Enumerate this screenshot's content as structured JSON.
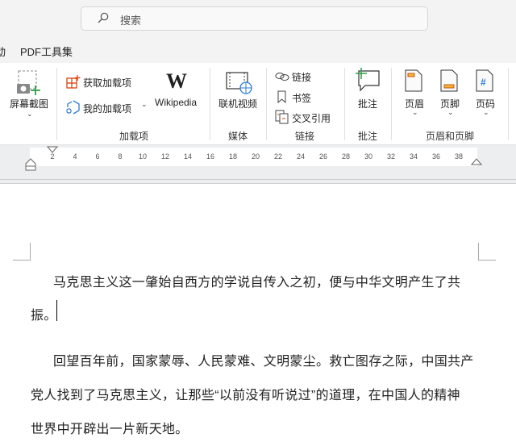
{
  "search": {
    "placeholder": "搜索"
  },
  "tabs": [
    {
      "label": "动"
    },
    {
      "label": "PDF工具集"
    }
  ],
  "ribbon": {
    "screenshot": "屏幕截图",
    "get_addins": "获取加载项",
    "my_addins": "我的加载项",
    "wikipedia": "Wikipedia",
    "online_video": "联机视频",
    "link": "链接",
    "bookmark": "书签",
    "cross_ref": "交叉引用",
    "comment": "批注",
    "header": "页眉",
    "footer": "页脚",
    "page_number": "页码",
    "groups": {
      "addins": "加载项",
      "media": "媒体",
      "links": "链接",
      "comments": "批注",
      "header_footer": "页眉和页脚"
    }
  },
  "ruler": {
    "ticks": [
      "2",
      "4",
      "6",
      "8",
      "10",
      "12",
      "14",
      "16",
      "18",
      "20",
      "22",
      "24",
      "26",
      "28",
      "30",
      "32",
      "34",
      "36",
      "38"
    ]
  },
  "document": {
    "lines": [
      "马克思主义这一肇始自西方的学说自传入之初，便与中华文明产生了共",
      "振。",
      "回望百年前，国家蒙辱、人民蒙难、文明蒙尘。救亡图存之际，中国共产",
      "党人找到了马克思主义，让那些“以前没有听说过”的道理，在中国人的精神",
      "世界中开辟出一片新天地。"
    ]
  },
  "colors": {
    "accent_orange": "#d83b01",
    "green": "#2e9e44",
    "blue": "#2b7cd3"
  }
}
